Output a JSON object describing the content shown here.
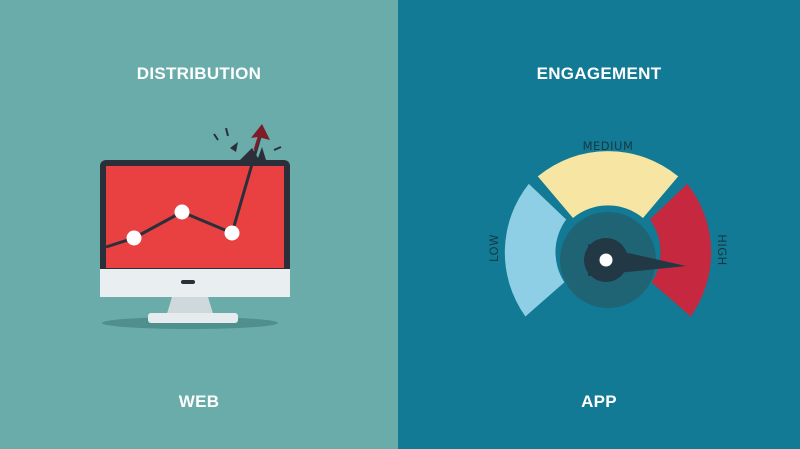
{
  "colors": {
    "left_bg": "#69acaa",
    "right_bg": "#127a95",
    "screen_red": "#e94141",
    "gauge_low": "#8ecfe6",
    "gauge_medium": "#f6e5a3",
    "gauge_high": "#c5283f",
    "gauge_hub": "#1f6475",
    "needle": "#223844",
    "arrow": "#7c1d29"
  },
  "left": {
    "heading": "DISTRIBUTION",
    "footer": "WEB"
  },
  "right": {
    "heading": "ENGAGEMENT",
    "footer": "APP",
    "gauge": {
      "low_label": "LOW",
      "medium_label": "MEDIUM",
      "high_label": "HIGH"
    }
  }
}
